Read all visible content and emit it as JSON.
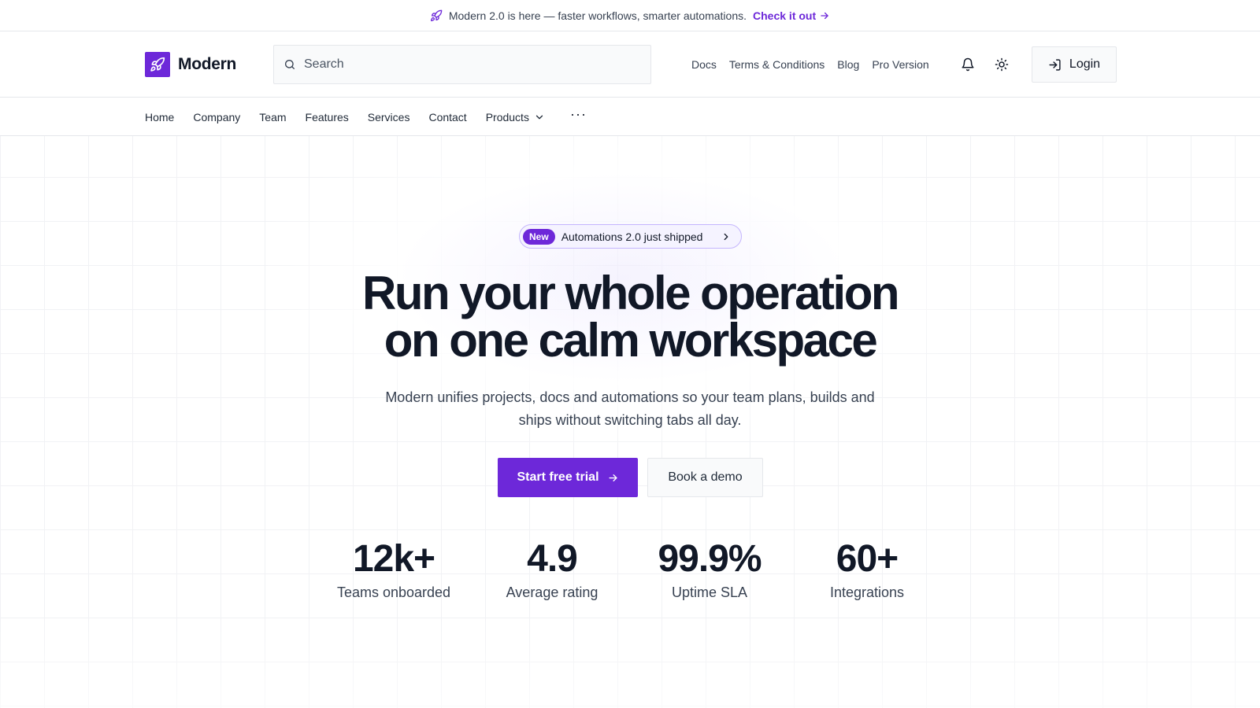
{
  "announcement": {
    "text": "Modern 2.0 is here — faster workflows, smarter automations.",
    "link_label": "Check it out"
  },
  "brand": {
    "name": "Modern",
    "accent_color": "#6d28d9"
  },
  "header": {
    "search_placeholder": "Search",
    "links": [
      "Docs",
      "Terms & Conditions",
      "Blog",
      "Pro Version"
    ],
    "login_label": "Login"
  },
  "nav": {
    "items": [
      "Home",
      "Company",
      "Team",
      "Features",
      "Services",
      "Contact",
      "Products"
    ],
    "more_label": "···"
  },
  "hero": {
    "badge": "New",
    "pill_text": "Automations 2.0 just shipped",
    "headline_line1": "Run your whole operation",
    "headline_line2": "on one calm workspace",
    "sub_line1": "Modern unifies projects, docs and automations so your team plans, builds and",
    "sub_line2": "ships without switching tabs all day.",
    "primary_cta": "Start free trial",
    "secondary_cta": "Book a demo"
  },
  "stats": [
    {
      "value": "12k+",
      "label": "Teams onboarded"
    },
    {
      "value": "4.9",
      "label": "Average rating"
    },
    {
      "value": "99.9%",
      "label": "Uptime SLA"
    },
    {
      "value": "60+",
      "label": "Integrations"
    }
  ],
  "icons": {
    "announce": "rocket-icon",
    "logo": "rocket-icon",
    "search": "search-icon",
    "notifications": "bell-icon",
    "theme": "sun-icon",
    "login": "login-icon"
  }
}
